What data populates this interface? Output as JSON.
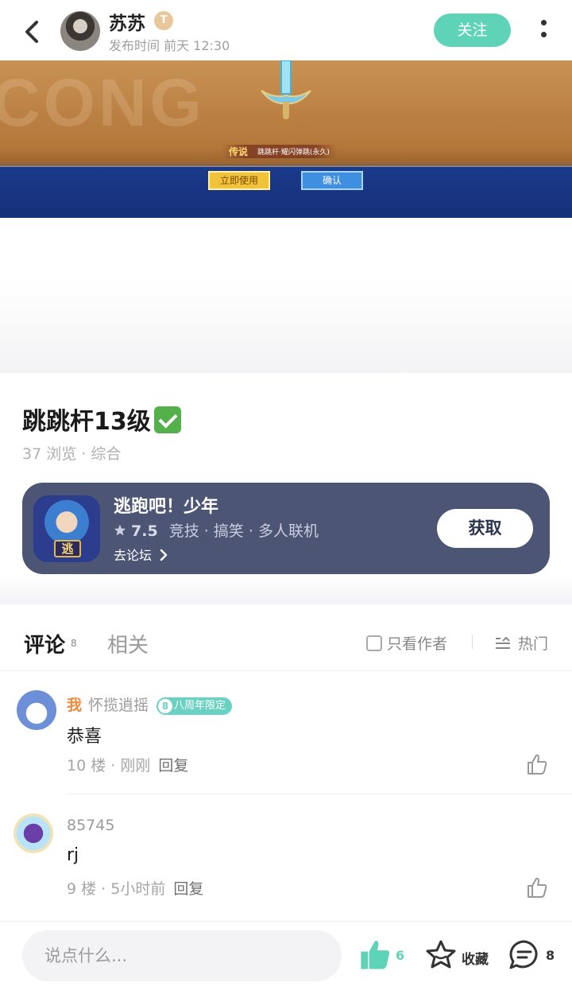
{
  "header": {
    "author_name": "苏苏",
    "author_badge": "T",
    "publish_time": "发布时间 前天 12:30",
    "follow_label": "关注"
  },
  "banner": {
    "bg_text": "CONG",
    "legend_tag": "传说",
    "legend_item": "跳跳杆·耀闪弹跳(永久)",
    "use_now": "立即使用",
    "confirm": "确认"
  },
  "post": {
    "title": "跳跳杆13级",
    "meta": "37 浏览 · 综合"
  },
  "game": {
    "icon_char": "逃",
    "name": "逃跑吧！少年",
    "score": "7.5",
    "tags": "竞技 · 搞笑 · 多人联机",
    "forum_link": "去论坛",
    "get_label": "获取"
  },
  "tabs": {
    "comments_label": "评论",
    "comments_count": "8",
    "related_label": "相关",
    "only_author_label": "只看作者",
    "sort_label": "热门"
  },
  "comments": [
    {
      "me_label": "我",
      "name": "怀揽逍摇",
      "badge_num": "8",
      "badge_text": "八周年限定",
      "text": "恭喜",
      "meta": "10 楼 · 刚刚",
      "reply_label": "回复"
    },
    {
      "name": "85745",
      "text": "rj",
      "meta": "9 楼 · 5小时前",
      "reply_label": "回复"
    }
  ],
  "bottom_bar": {
    "input_placeholder": "说点什么...",
    "like_count": "6",
    "favorite_label": "收藏",
    "comment_count": "8"
  },
  "colors": {
    "accent": "#5fd3b7",
    "card_bg": "#4d5574",
    "me_label": "#f08a3c"
  }
}
